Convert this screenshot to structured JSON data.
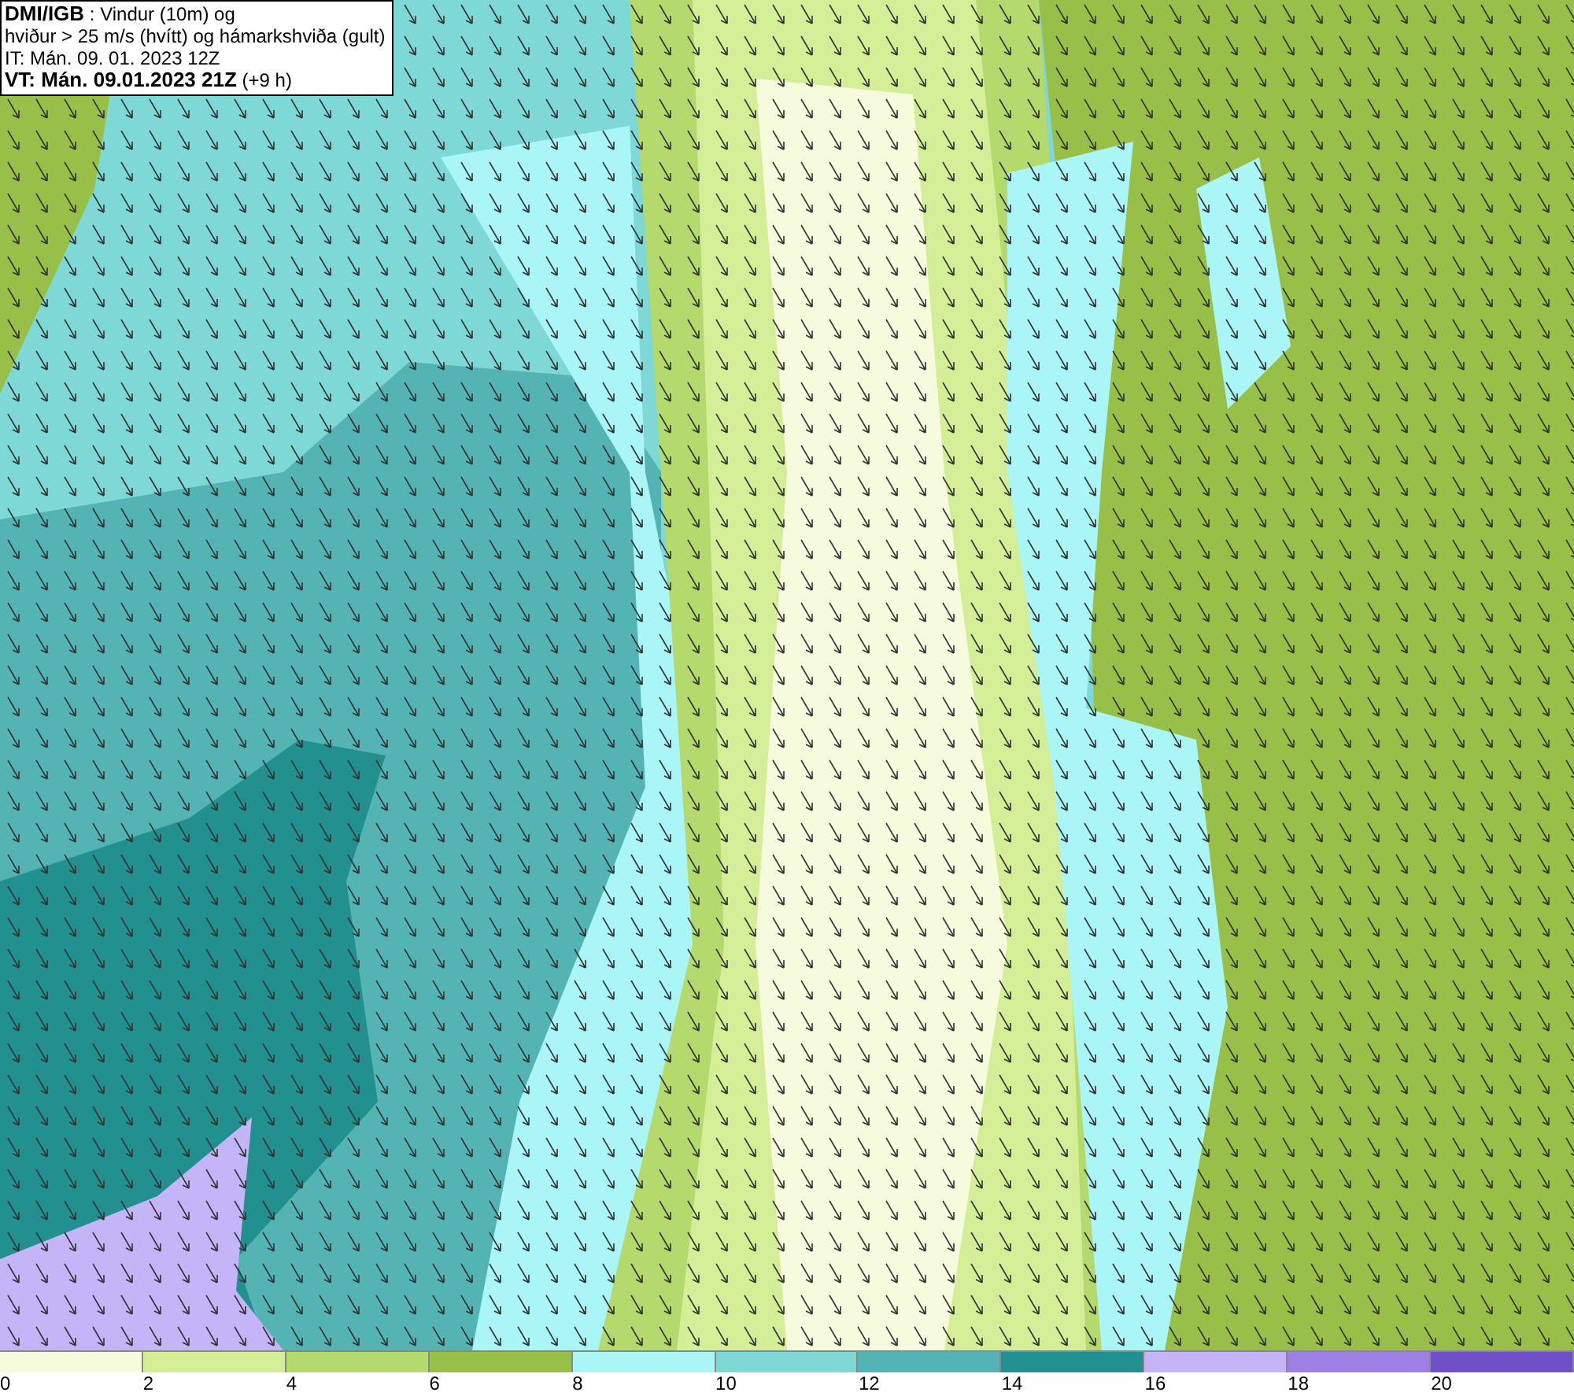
{
  "title_box": {
    "lines": [
      "**DMI/IGB** : Vindur (10m) og",
      "hviður > 25 m/s (hvítt) og hámarkshviða (gult)",
      "IT: Mán. 09. 01. 2023 12Z",
      "**VT: Mán. 09.01.2023 21Z** (+9 h)"
    ]
  },
  "legend": {
    "bins": [
      {
        "color": "#f5fbdc",
        "label": "0"
      },
      {
        "color": "#d4ee98",
        "label": "2"
      },
      {
        "color": "#b4d96c",
        "label": "4"
      },
      {
        "color": "#98c048",
        "label": "6"
      },
      {
        "color": "#aaf5f5",
        "label": "8"
      },
      {
        "color": "#7dd8d6",
        "label": "10"
      },
      {
        "color": "#54b4b4",
        "label": "12"
      },
      {
        "color": "#239090",
        "label": "14"
      },
      {
        "color": "#c4b4f8",
        "label": "16"
      },
      {
        "color": "#9e80e4",
        "label": "18"
      },
      {
        "color": "#7050c8",
        "label": "20"
      }
    ]
  }
}
